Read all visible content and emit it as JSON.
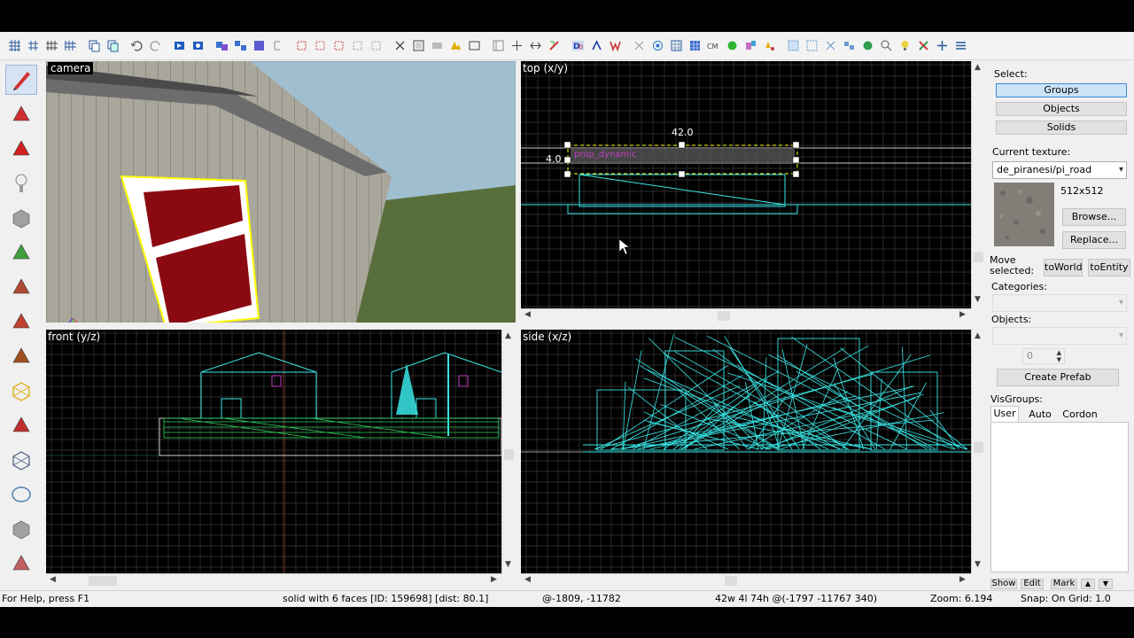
{
  "viewports": {
    "camera": {
      "label": "camera"
    },
    "top": {
      "label": "top (x/y)",
      "dim_width": "42.0",
      "dim_height": "4.0",
      "entity_name": "prop_dynamic"
    },
    "front": {
      "label": "front (y/z)"
    },
    "side": {
      "label": "side (x/z)"
    }
  },
  "right_panel": {
    "select_label": "Select:",
    "groups": "Groups",
    "objects_btn": "Objects",
    "solids": "Solids",
    "current_texture_label": "Current texture:",
    "texture_name": "de_piranesi/pi_road",
    "texture_size": "512x512",
    "browse": "Browse...",
    "replace": "Replace...",
    "move_selected": "Move selected:",
    "to_world": "toWorld",
    "to_entity": "toEntity",
    "categories_label": "Categories:",
    "objects_label": "Objects:",
    "count_value": "0",
    "create_prefab": "Create Prefab",
    "visgroups_label": "VisGroups:",
    "tab_user": "User",
    "tab_auto": "Auto",
    "tab_cordon": "Cordon",
    "show": "Show",
    "edit": "Edit",
    "mark": "Mark"
  },
  "status": {
    "help": "For Help, press F1",
    "selection": "solid with 6 faces  [ID: 159698]  [dist: 80.1]",
    "coords": "@-1809, -11782",
    "size": "42w 4l 74h @(-1797 -11767 340)",
    "zoom": "Zoom: 6.194",
    "snap": "Snap: On Grid: 1.0"
  },
  "colors": {
    "wire": "#39e6e6",
    "grid": "#3a3a3a",
    "selection": "#ffff00",
    "entity": "#c040c0",
    "accent": "#cce4f7"
  },
  "toolbar_icons": [
    "grid-toggle-icon",
    "grid-3d-icon",
    "grid-smaller-icon",
    "grid-larger-icon",
    "copy-icon",
    "paste-icon",
    "undo-icon",
    "redo-icon",
    "run-map-icon",
    "carve-icon",
    "group-icon",
    "ungroup-icon",
    "hide-icon",
    "tie-icon",
    "cut-icon",
    "clone-icon",
    "save-icon",
    "texture-lock-icon",
    "texture-app-icon",
    "decal-icon",
    "select-tool-icon",
    "camera-icon",
    "entity-icon",
    "block-icon",
    "texture-icon"
  ],
  "left_tools": [
    "selection-tool-icon",
    "magnify-tool-icon",
    "camera-tool-icon",
    "entity-tool-icon",
    "block-tool-icon",
    "texture-app-tool-icon",
    "apply-texture-tool-icon",
    "apply-decal-tool-icon",
    "apply-overlay-tool-icon",
    "clip-tool-icon",
    "vertex-tool-icon",
    "path-tool-icon",
    "sphere-tool-icon",
    "cube-tool-icon",
    "overlay-tool-icon"
  ]
}
